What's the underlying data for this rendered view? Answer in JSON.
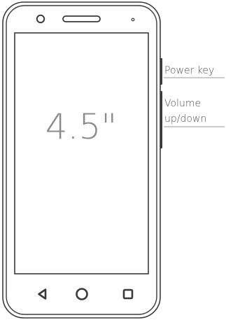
{
  "screen_size_label": "4.5\"",
  "callouts": {
    "power_key": "Power key",
    "volume_line1": "Volume",
    "volume_line2": "up/down"
  },
  "icons": {
    "front_camera": "front-camera-icon",
    "speaker": "earpiece-speaker-icon",
    "sensor": "proximity-sensor-icon",
    "back": "back-triangle-icon",
    "home": "home-circle-icon",
    "recents": "recents-square-icon"
  },
  "colors": {
    "outline": "#3a3a3a",
    "label": "#8a8a8a",
    "callout_text": "#555555",
    "callout_line": "#9a9a9a"
  }
}
